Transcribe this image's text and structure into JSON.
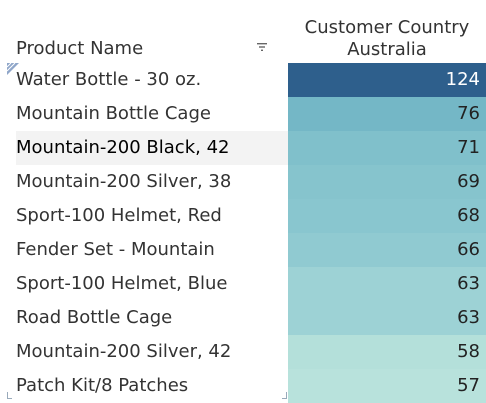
{
  "header": {
    "row_field": "Product Name",
    "column_field": "Customer Country",
    "column_value": "Australia"
  },
  "rows": [
    {
      "name": "Water Bottle - 30 oz.",
      "value": "124",
      "color": "#2e5f8c"
    },
    {
      "name": "Mountain Bottle Cage",
      "value": "76",
      "color": "#74b7c6"
    },
    {
      "name": "Mountain-200 Black, 42",
      "value": "71",
      "color": "#80c0cb"
    },
    {
      "name": "Mountain-200 Silver, 38",
      "value": "69",
      "color": "#86c4cd"
    },
    {
      "name": "Sport-100 Helmet, Red",
      "value": "68",
      "color": "#89c6cf"
    },
    {
      "name": "Fender Set - Mountain",
      "value": "66",
      "color": "#90cad1"
    },
    {
      "name": "Sport-100 Helmet, Blue",
      "value": "63",
      "color": "#9dd2d5"
    },
    {
      "name": "Road Bottle Cage",
      "value": "63",
      "color": "#9dd2d5"
    },
    {
      "name": "Mountain-200 Silver, 42",
      "value": "58",
      "color": "#b4e0da"
    },
    {
      "name": "Patch Kit/8 Patches",
      "value": "57",
      "color": "#b8e2dc"
    }
  ],
  "icons": {
    "sort": "sort-descending-icon",
    "selection_corner": "selection-corner-icon"
  }
}
